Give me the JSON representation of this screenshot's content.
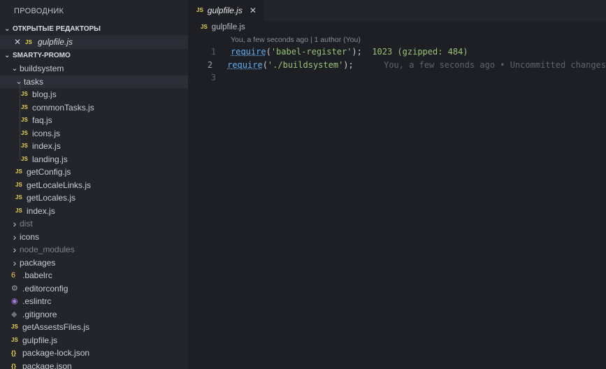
{
  "sidebar": {
    "title": "ПРОВОДНИК",
    "open_editors": {
      "header": "ОТКРЫТЫЕ РЕДАКТОРЫ",
      "items": [
        {
          "icon": "JS",
          "name": "gulpfile.js"
        }
      ]
    },
    "project": {
      "header": "SMARTY-PROMO",
      "tree": [
        {
          "label": "buildsystem",
          "type": "folder",
          "open": true,
          "depth": 1
        },
        {
          "label": "tasks",
          "type": "folder",
          "open": true,
          "depth": 2,
          "active": true
        },
        {
          "label": "blog.js",
          "type": "js",
          "depth": 3
        },
        {
          "label": "commonTasks.js",
          "type": "js",
          "depth": 3
        },
        {
          "label": "faq.js",
          "type": "js",
          "depth": 3
        },
        {
          "label": "icons.js",
          "type": "js",
          "depth": 3
        },
        {
          "label": "index.js",
          "type": "js",
          "depth": 3
        },
        {
          "label": "landing.js",
          "type": "js",
          "depth": 3
        },
        {
          "label": "getConfig.js",
          "type": "js",
          "depth": 2
        },
        {
          "label": "getLocaleLinks.js",
          "type": "js",
          "depth": 2
        },
        {
          "label": "getLocales.js",
          "type": "js",
          "depth": 2
        },
        {
          "label": "index.js",
          "type": "js",
          "depth": 2
        },
        {
          "label": "dist",
          "type": "folder",
          "open": false,
          "depth": 1,
          "dim": true
        },
        {
          "label": "icons",
          "type": "folder",
          "open": false,
          "depth": 1
        },
        {
          "label": "node_modules",
          "type": "folder",
          "open": false,
          "depth": 1,
          "dim": true
        },
        {
          "label": "packages",
          "type": "folder",
          "open": false,
          "depth": 1
        },
        {
          "label": ".babelrc",
          "type": "babel",
          "depth": 1
        },
        {
          "label": ".editorconfig",
          "type": "gear",
          "depth": 1
        },
        {
          "label": ".eslintrc",
          "type": "eslint",
          "depth": 1
        },
        {
          "label": ".gitignore",
          "type": "git",
          "depth": 1
        },
        {
          "label": "getAssestsFiles.js",
          "type": "js",
          "depth": 1
        },
        {
          "label": "gulpfile.js",
          "type": "js",
          "depth": 1
        },
        {
          "label": "package-lock.json",
          "type": "json",
          "depth": 1
        },
        {
          "label": "package.json",
          "type": "json",
          "depth": 1
        }
      ]
    }
  },
  "editor": {
    "tab": {
      "icon": "JS",
      "name": "gulpfile.js",
      "close": "✕"
    },
    "breadcrumb": {
      "icon": "JS",
      "name": "gulpfile.js"
    },
    "codelens": "You, a few seconds ago | 1 author (You)",
    "lines": [
      {
        "num": "1",
        "fn": "require",
        "open": "(",
        "str": "'babel-register'",
        "close": ");",
        "size": "1023 (gzipped: 484)",
        "blame": ""
      },
      {
        "num": "2",
        "fn": "require",
        "open": "(",
        "str": "'./buildsystem'",
        "close": ");",
        "size": "",
        "blame": "You, a few seconds ago • Uncommitted changes"
      },
      {
        "num": "3",
        "fn": "",
        "open": "",
        "str": "",
        "close": "",
        "size": "",
        "blame": ""
      }
    ]
  },
  "colors": {
    "sidebar_bg": "#23252b",
    "editor_bg": "#1e1f24",
    "js_icon": "#e8d44d",
    "function": "#61afef",
    "string": "#98c379"
  },
  "icons": {
    "close": "close-icon",
    "chevron_down": "chevron-down-icon",
    "chevron_right": "chevron-right-icon",
    "js_file": "js-file-icon",
    "json_file": "json-file-icon"
  }
}
